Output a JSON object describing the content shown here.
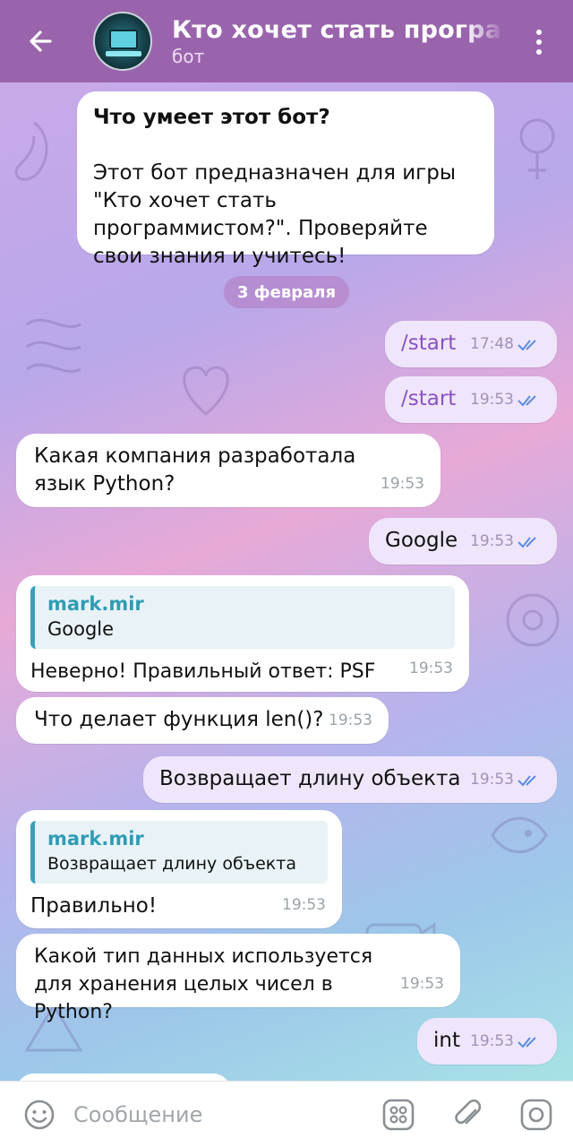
{
  "header": {
    "title": "Кто хочет стать программистом?",
    "subtitle": "бот",
    "back_icon": "arrow-left-icon",
    "menu_icon": "more-vertical-icon"
  },
  "colors": {
    "header_bg": "#9a64ad",
    "bubble_in": "#ffffff",
    "bubble_out": "#efe6fb",
    "reply_accent": "#3aa0b8",
    "command": "#8a52c2"
  },
  "intro": {
    "heading": "Что умеет этот бот?",
    "body": "Этот бот предназначен для игры \"Кто хочет стать программистом?\". Проверяйте свои знания и учитесь!"
  },
  "date_separator": "3 февраля",
  "messages": [
    {
      "dir": "out",
      "text": "/start",
      "time": "17:48",
      "read": true
    },
    {
      "dir": "out",
      "text": "/start",
      "time": "19:53",
      "read": true
    },
    {
      "dir": "in",
      "text": "Какая компания разработала язык Python?",
      "time": "19:53"
    },
    {
      "dir": "out",
      "text": "Google",
      "time": "19:53",
      "read": true
    },
    {
      "dir": "in",
      "reply_author": "mark.mir",
      "reply_text": "Google",
      "text": "Неверно! Правильный ответ: PSF",
      "time": "19:53"
    },
    {
      "dir": "in",
      "text": "Что делает функция len()?",
      "time": "19:53"
    },
    {
      "dir": "out",
      "text": "Возвращает длину объекта",
      "time": "19:53",
      "read": true
    },
    {
      "dir": "in",
      "reply_author": "mark.mir",
      "reply_text": "Возвращает длину объекта",
      "text": "Правильно!",
      "time": "19:53"
    },
    {
      "dir": "in",
      "text": "Какой тип данных используется для хранения целых чисел в Python?",
      "time": "19:53"
    },
    {
      "dir": "out",
      "text": "int",
      "time": "19:53",
      "read": true
    }
  ],
  "input": {
    "placeholder": "Сообщение",
    "emoji_icon": "smile-icon",
    "keyboard_icon": "bot-keyboard-icon",
    "attach_icon": "paperclip-icon",
    "camera_icon": "camera-icon"
  }
}
